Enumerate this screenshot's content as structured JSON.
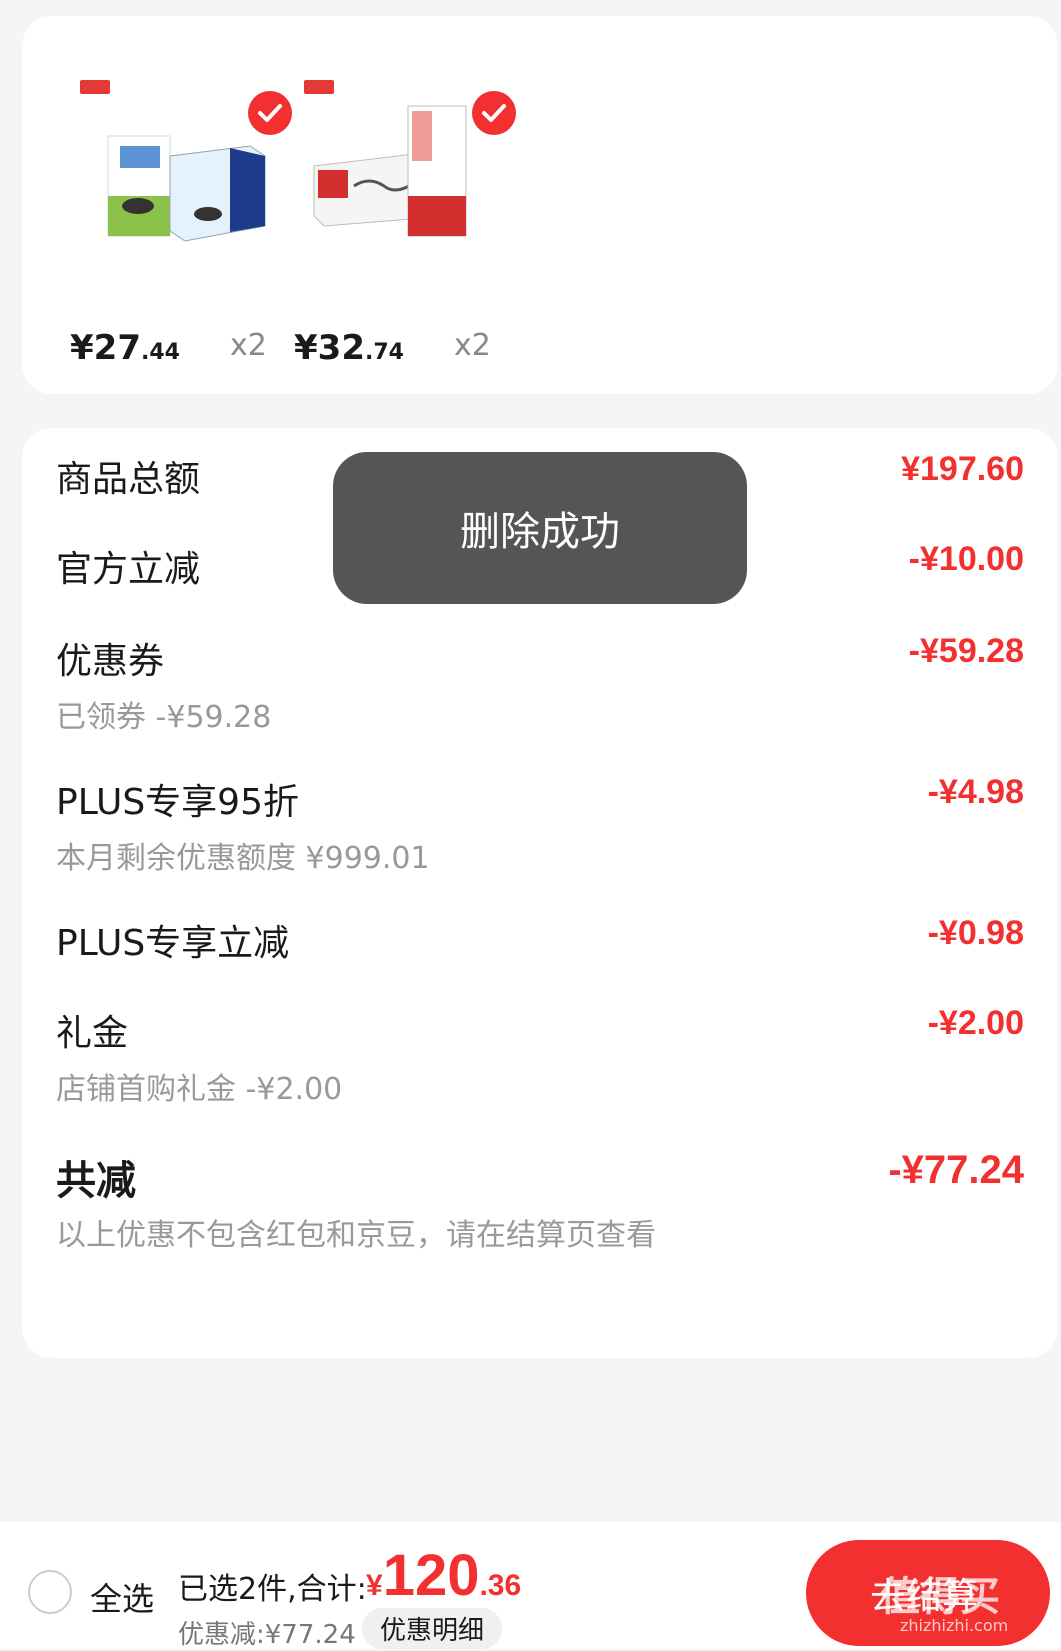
{
  "products": [
    {
      "price_int": "¥27",
      "price_dec": ".44",
      "qty": "x2",
      "image_name": "milk-box-product-image"
    },
    {
      "price_int": "¥32",
      "price_dec": ".74",
      "qty": "x2",
      "image_name": "milk-1928-product-image"
    }
  ],
  "summary": {
    "goods_total": {
      "label": "商品总额",
      "amount": "¥197.60"
    },
    "official_discount": {
      "label": "官方立减",
      "amount": "-¥10.00"
    },
    "coupon": {
      "label": "优惠券",
      "amount": "-¥59.28",
      "sub": "已领券 -¥59.28"
    },
    "plus_95": {
      "label": "PLUS专享95折",
      "amount": "-¥4.98",
      "sub": "本月剩余优惠额度 ¥999.01"
    },
    "plus_discount": {
      "label": "PLUS专享立减",
      "amount": "-¥0.98"
    },
    "gift": {
      "label": "礼金",
      "amount": "-¥2.00",
      "sub": "店铺首购礼金 -¥2.00"
    },
    "total_discount": {
      "label": "共减",
      "amount": "-¥77.24",
      "sub": "以上优惠不包含红包和京豆，请在结算页查看"
    }
  },
  "toast": "删除成功",
  "bottom": {
    "select_all": "全选",
    "selected_info": "已选2件,合计:",
    "total_currency": "¥",
    "total_int": "120",
    "total_dec": ".36",
    "discount_info": "优惠减:¥77.24",
    "discount_detail": "优惠明细",
    "checkout": "去结算",
    "watermark": "值得买",
    "watermark_url": "zhizhizhi.com"
  },
  "colors": {
    "accent": "#f23030",
    "toast_bg": "#555555",
    "page_bg": "#f5f5f5"
  }
}
